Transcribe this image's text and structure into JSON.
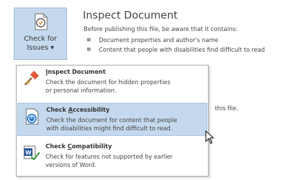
{
  "check_for_issues": {
    "label_line1": "Check for",
    "label_line2": "Issues ▾"
  },
  "inspect_section": {
    "title": "Inspect Document",
    "description": "Before publishing this file, be aware that it contains:",
    "bullets": [
      "Document properties and author's name",
      "Content that people with disabilities find difficult to read"
    ],
    "partial_text": "this file."
  },
  "menu": {
    "items": [
      {
        "title_html_hint": "I",
        "title_pre": "",
        "title_accel": "I",
        "title_post": "nspect Document",
        "desc_line1": "Check the document for hidden properties",
        "desc_line2": "or personal information."
      },
      {
        "title_pre": "Check ",
        "title_accel": "A",
        "title_post": "ccessibility",
        "desc_line1": "Check the document for content that people",
        "desc_line2": "with disabilities might find difficult to read."
      },
      {
        "title_pre": "Check ",
        "title_accel": "C",
        "title_post": "ompatibility",
        "desc_line1": "Check for features not supported by earlier",
        "desc_line2": "versions of Word."
      }
    ]
  },
  "colors": {
    "hover_bg": "#c5d9ee",
    "text": "#444444"
  }
}
